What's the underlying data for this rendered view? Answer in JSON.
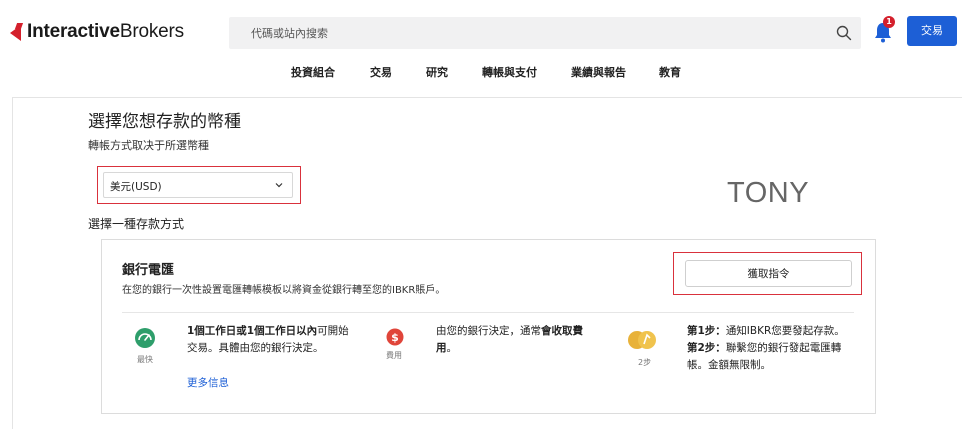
{
  "header": {
    "logo_bold": "Interactive",
    "logo_light": "Brokers",
    "search_placeholder": "代碼或站內搜索",
    "notification_count": "1",
    "trade_label": "交易"
  },
  "nav": {
    "items": [
      "投資組合",
      "交易",
      "研究",
      "轉帳與支付",
      "業績與報告",
      "教育"
    ]
  },
  "page": {
    "title": "選擇您想存款的幣種",
    "subtitle": "轉帳方式取决于所選幣種",
    "currency_selected": "美元(USD)",
    "watermark_name": "TONY",
    "method_label": "選擇一種存款方式"
  },
  "wire": {
    "title": "銀行電匯",
    "description": "在您的銀行一次性設置電匯轉帳模板以將資金從銀行轉至您的IBKR賬戶。",
    "get_button": "獲取指令",
    "speed_caption": "最快",
    "speed_bold": "1個工作日或1個工作日以內",
    "speed_text_1": "可開始",
    "speed_text_2": "交易。具體由您的銀行決定。",
    "fee_caption": "費用",
    "fee_text_1": "由您的銀行決定，通常",
    "fee_bold_1": "會收取費",
    "fee_bold_2": "用",
    "fee_text_2": "。",
    "steps_caption": "2步",
    "step1_bold": "第1步：",
    "step1_text": "通知IBKR您要發起存款。",
    "step2_bold": "第2步：",
    "step2_text": "聯繫您的銀行發起電匯轉",
    "step2_text_cont": "帳。金額無限制。",
    "more_info": "更多信息"
  },
  "colors": {
    "accent_blue": "#1d5fd6",
    "brand_red": "#d4202c",
    "highlight_red": "#d9313c",
    "speed_green": "#2e9e6b",
    "fee_red": "#e0453a",
    "steps_gold": "#e8b23a"
  }
}
